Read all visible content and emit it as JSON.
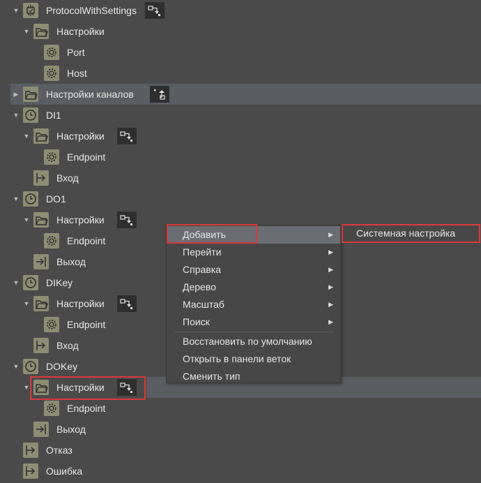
{
  "tree": [
    {
      "label": "ProtocolWithSettings",
      "icon": "protocol-icon",
      "arrow": "expanded",
      "action": "add-icon"
    },
    {
      "label": "Настройки",
      "icon": "folder-icon",
      "arrow": "expanded",
      "action": ""
    },
    {
      "label": "Port",
      "icon": "gear-icon",
      "arrow": "",
      "action": ""
    },
    {
      "label": "Host",
      "icon": "gear-icon",
      "arrow": "",
      "action": ""
    },
    {
      "label": "Настройки каналов",
      "icon": "folder-icon",
      "arrow": "collapsed",
      "action": "move-icon",
      "highlight": true
    },
    {
      "label": "DI1",
      "icon": "clock-icon",
      "arrow": "expanded",
      "action": ""
    },
    {
      "label": "Настройки",
      "icon": "folder-icon",
      "arrow": "expanded",
      "action": "add-icon"
    },
    {
      "label": "Endpoint",
      "icon": "gear-icon",
      "arrow": "",
      "action": ""
    },
    {
      "label": "Вход",
      "icon": "input-icon",
      "arrow": "",
      "action": ""
    },
    {
      "label": "DO1",
      "icon": "clock-icon",
      "arrow": "expanded",
      "action": ""
    },
    {
      "label": "Настройки",
      "icon": "folder-icon",
      "arrow": "expanded",
      "action": "add-icon"
    },
    {
      "label": "Endpoint",
      "icon": "gear-icon",
      "arrow": "",
      "action": ""
    },
    {
      "label": "Выход",
      "icon": "output-icon",
      "arrow": "",
      "action": ""
    },
    {
      "label": "DIKey",
      "icon": "clock-icon",
      "arrow": "expanded",
      "action": ""
    },
    {
      "label": "Настройки",
      "icon": "folder-icon",
      "arrow": "expanded",
      "action": "add-icon"
    },
    {
      "label": "Endpoint",
      "icon": "gear-icon",
      "arrow": "",
      "action": ""
    },
    {
      "label": "Вход",
      "icon": "input-icon",
      "arrow": "",
      "action": ""
    },
    {
      "label": "DOKey",
      "icon": "clock-icon",
      "arrow": "expanded",
      "action": ""
    },
    {
      "label": "Настройки",
      "icon": "folder-icon",
      "arrow": "expanded",
      "action": "add-icon",
      "highlight": true
    },
    {
      "label": "Endpoint",
      "icon": "gear-icon",
      "arrow": "",
      "action": ""
    },
    {
      "label": "Выход",
      "icon": "output-icon",
      "arrow": "",
      "action": ""
    },
    {
      "label": "Отказ",
      "icon": "input-icon",
      "arrow": "",
      "action": ""
    },
    {
      "label": "Ошибка",
      "icon": "input-icon",
      "arrow": "",
      "action": ""
    }
  ],
  "context_menu": {
    "items": [
      {
        "label": "Добавить",
        "submenu": true,
        "active": true
      },
      {
        "label": "Перейти",
        "submenu": true
      },
      {
        "label": "Справка",
        "submenu": true
      },
      {
        "label": "Дерево",
        "submenu": true
      },
      {
        "label": "Масштаб",
        "submenu": true
      },
      {
        "label": "Поиск",
        "submenu": true
      },
      {
        "separator": true
      },
      {
        "label": "Восстановить по умолчанию",
        "submenu": false
      },
      {
        "label": "Открыть в панели веток",
        "submenu": false
      },
      {
        "label": "Сменить тип",
        "submenu": false
      }
    ],
    "submenu_items": [
      {
        "label": "Системная настройка"
      }
    ]
  },
  "colors": {
    "background": "#4a4a4a",
    "row_highlight": "#5a5d62",
    "icon_bg": "#8d8d73",
    "action_bg": "#2e2e2e",
    "menu_bg": "#474747",
    "menu_active": "#6a6d72",
    "callout": "#d83a3a"
  }
}
